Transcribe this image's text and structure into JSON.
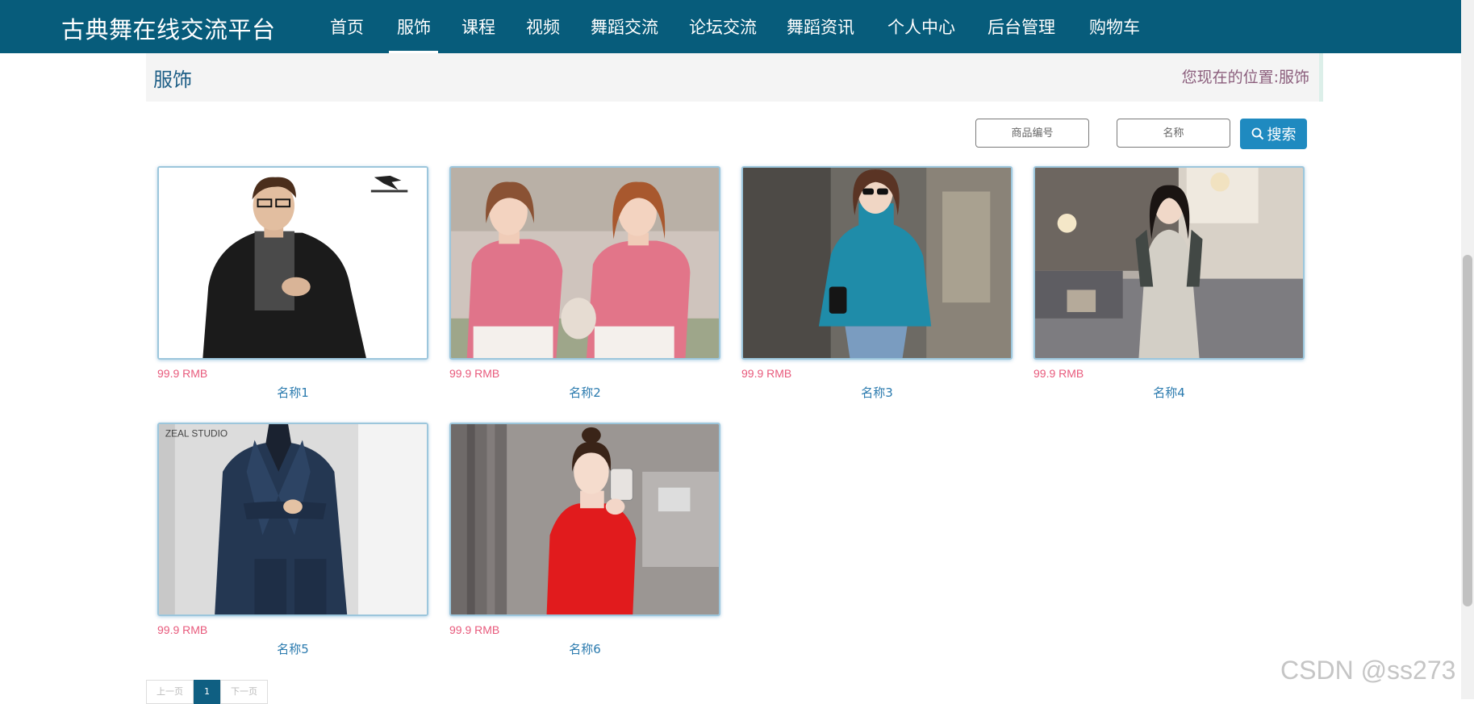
{
  "header": {
    "brand": "古典舞在线交流平台",
    "nav": [
      {
        "label": "首页",
        "name": "nav-home"
      },
      {
        "label": "服饰",
        "name": "nav-apparel",
        "active": true
      },
      {
        "label": "课程",
        "name": "nav-courses"
      },
      {
        "label": "视频",
        "name": "nav-videos"
      },
      {
        "label": "舞蹈交流",
        "name": "nav-dance-exchange"
      },
      {
        "label": "论坛交流",
        "name": "nav-forum"
      },
      {
        "label": "舞蹈资讯",
        "name": "nav-dance-news"
      },
      {
        "label": "个人中心",
        "name": "nav-profile"
      },
      {
        "label": "后台管理",
        "name": "nav-admin"
      },
      {
        "label": "购物车",
        "name": "nav-cart"
      }
    ],
    "bg_color": "#075c7b"
  },
  "page": {
    "title": "服饰",
    "location_label": "您现在的位置:",
    "location_value": "服饰"
  },
  "search": {
    "code_placeholder": "商品编号",
    "name_placeholder": "名称",
    "button_label": "搜索",
    "button_icon": "search-icon"
  },
  "products": [
    {
      "price": "99.9 RMB",
      "name": "名称1",
      "image": "man-black-jacket-scarf"
    },
    {
      "price": "99.9 RMB",
      "name": "名称2",
      "image": "two-women-pink-tops"
    },
    {
      "price": "99.9 RMB",
      "name": "名称3",
      "image": "woman-blue-sweater"
    },
    {
      "price": "99.9 RMB",
      "name": "名称4",
      "image": "woman-grey-dress"
    },
    {
      "price": "99.9 RMB",
      "name": "名称5",
      "image": "man-navy-suit"
    },
    {
      "price": "99.9 RMB",
      "name": "名称6",
      "image": "woman-red-top"
    }
  ],
  "pagination": {
    "prev": "上一页",
    "current": "1",
    "next": "下一页"
  },
  "watermark": "CSDN @ss273",
  "colors": {
    "price": "#e85a7c",
    "name": "#2a7aae",
    "accent": "#1f8ac0"
  }
}
